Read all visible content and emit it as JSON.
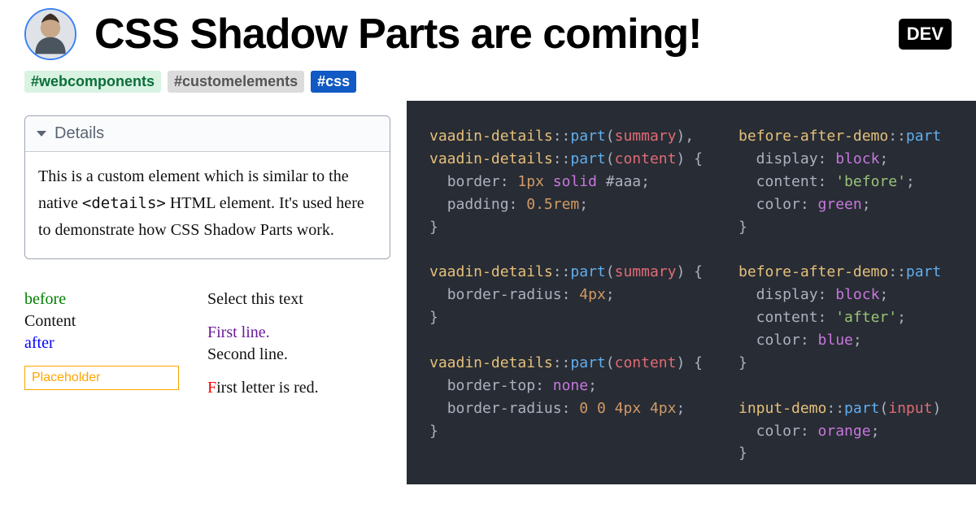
{
  "header": {
    "title": "CSS Shadow Parts are coming!",
    "badge": "DEV"
  },
  "tags": {
    "webcomponents": "#webcomponents",
    "customelements": "#customelements",
    "css": "#css"
  },
  "details": {
    "summary": "Details",
    "content_pre": "This is a custom element which is similar to the native ",
    "content_code": "<details>",
    "content_post": " HTML element. It's used here to demonstrate how CSS Shadow Parts work."
  },
  "demo": {
    "before": "before",
    "content": "Content",
    "after": "after",
    "placeholder": "Placeholder",
    "select_text": "Select this text",
    "first_line": "First line.",
    "second_line": "Second line.",
    "first_letter": "F",
    "first_letter_rest": "irst letter is red."
  },
  "code": {
    "sel_vaadin": "vaadin-details",
    "sel_bad": "before-after-demo",
    "sel_input": "input-demo",
    "pseudo_part": "part",
    "arg_summary": "summary",
    "arg_content": "content",
    "arg_input": "input",
    "prop_border": "border",
    "prop_padding": "padding",
    "prop_border_radius": "border-radius",
    "prop_border_top": "border-top",
    "prop_display": "display",
    "prop_content": "content",
    "prop_color": "color",
    "val_1px": "1px",
    "val_solid": "solid",
    "val_aaa": "#aaa",
    "val_05rem": "0.5rem",
    "val_4px": "4px",
    "val_none": "none",
    "val_004px4px": "0 0 4px 4px",
    "val_block": "block",
    "val_before_str": "'before'",
    "val_after_str": "'after'",
    "val_green": "green",
    "val_blue": "blue",
    "val_orange": "orange"
  }
}
